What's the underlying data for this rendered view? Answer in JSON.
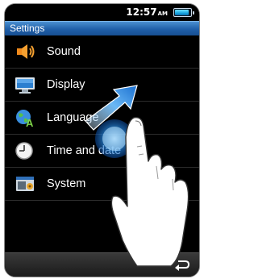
{
  "status": {
    "time": "12:57",
    "ampm": "AM"
  },
  "header": {
    "title": "Settings"
  },
  "menu": {
    "items": [
      {
        "label": "Sound",
        "icon": "speaker-icon"
      },
      {
        "label": "Display",
        "icon": "monitor-icon"
      },
      {
        "label": "Language",
        "icon": "globe-language-icon"
      },
      {
        "label": "Time and date",
        "icon": "clock-icon"
      },
      {
        "label": "System",
        "icon": "system-settings-icon"
      }
    ]
  },
  "footer": {
    "back_icon": "back-arrow-icon"
  },
  "colors": {
    "header": "#1f5fa8",
    "background": "#000000",
    "accent": "#1aa6e0"
  }
}
